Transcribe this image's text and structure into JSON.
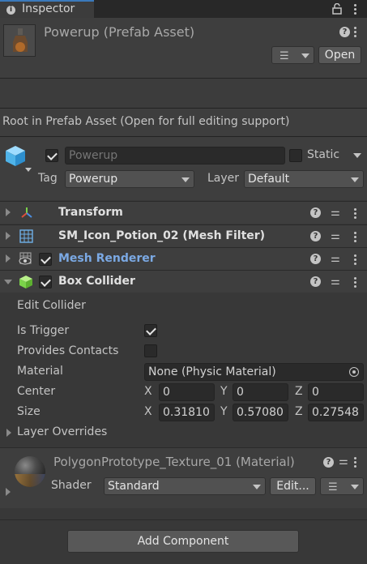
{
  "tab": {
    "label": "Inspector",
    "icon": "info-icon"
  },
  "asset": {
    "title": "Powerup (Prefab Asset)",
    "open_button": "Open",
    "root_notice": "Root in Prefab Asset (Open for full editing support)"
  },
  "gameobject": {
    "name_placeholder": "Powerup",
    "active": true,
    "static_label": "Static",
    "static": false,
    "tag_label": "Tag",
    "tag_value": "Powerup",
    "layer_label": "Layer",
    "layer_value": "Default"
  },
  "components": {
    "transform": "Transform",
    "mesh_filter": "SM_Icon_Potion_02 (Mesh Filter)",
    "mesh_renderer": "Mesh Renderer",
    "box_collider": "Box Collider"
  },
  "box_collider": {
    "edit_collider": "Edit Collider",
    "is_trigger_label": "Is Trigger",
    "is_trigger": true,
    "provides_contacts_label": "Provides Contacts",
    "provides_contacts": false,
    "material_label": "Material",
    "material_value": "None (Physic Material)",
    "center_label": "Center",
    "center": {
      "x": "0",
      "y": "0",
      "z": "0"
    },
    "size_label": "Size",
    "size": {
      "x": "0.31810",
      "y": "0.57080",
      "z": "0.27548"
    },
    "axis_x": "X",
    "axis_y": "Y",
    "axis_z": "Z",
    "layer_overrides": "Layer Overrides"
  },
  "material": {
    "title": "PolygonPrototype_Texture_01 (Material)",
    "shader_label": "Shader",
    "shader_value": "Standard",
    "edit_button": "Edit..."
  },
  "add_component": "Add Component",
  "colors": {
    "accent": "#3a79bb",
    "link": "#7ba9e4",
    "panel": "#383838",
    "header": "#3e3e3e"
  }
}
